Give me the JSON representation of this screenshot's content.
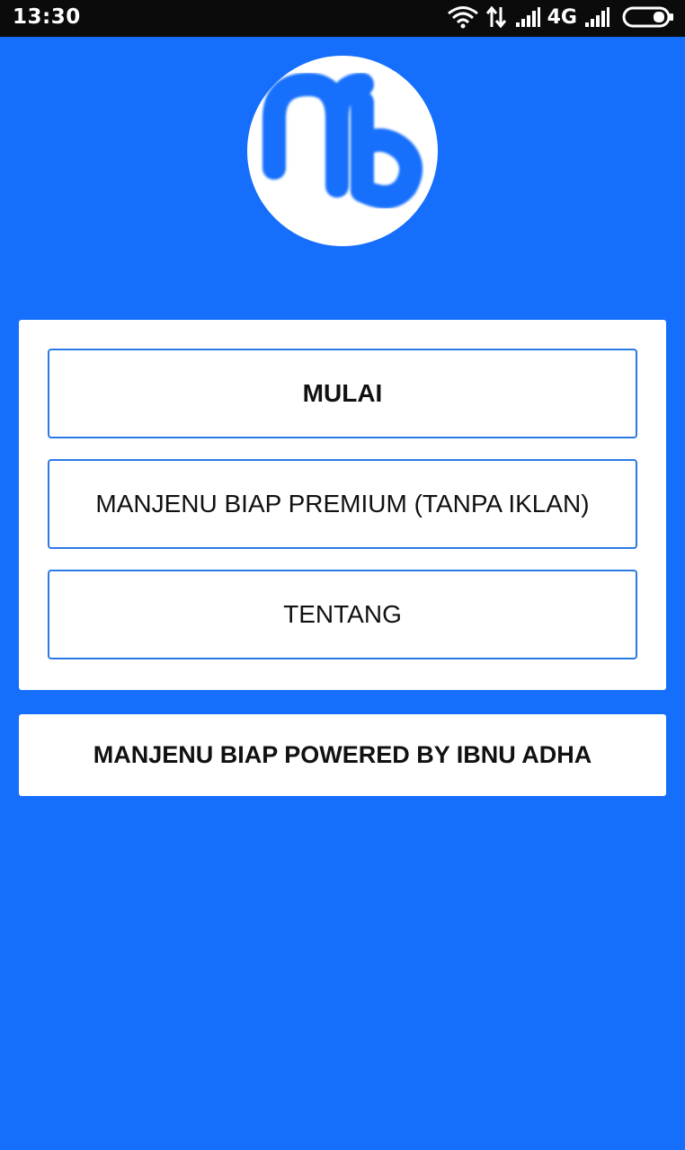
{
  "status_bar": {
    "time": "13:30",
    "network": "4G",
    "icons": [
      "wifi-icon",
      "data-transfer-icon",
      "signal-icon",
      "signal-icon",
      "battery-icon"
    ]
  },
  "logo": {
    "icon": "mb-logo-icon",
    "colors": {
      "background": "#ffffff",
      "glyph": "#166ffc"
    }
  },
  "menu": {
    "start_label": "MULAI",
    "premium_label": "MANJENU BIAP PREMIUM (TANPA IKLAN)",
    "about_label": "TENTANG"
  },
  "footer": {
    "text": "MANJENU BIAP POWERED BY IBNU ADHA"
  },
  "colors": {
    "background": "#166ffc",
    "button_border": "#2b7ae3",
    "status_bar": "#0b0b0b"
  }
}
